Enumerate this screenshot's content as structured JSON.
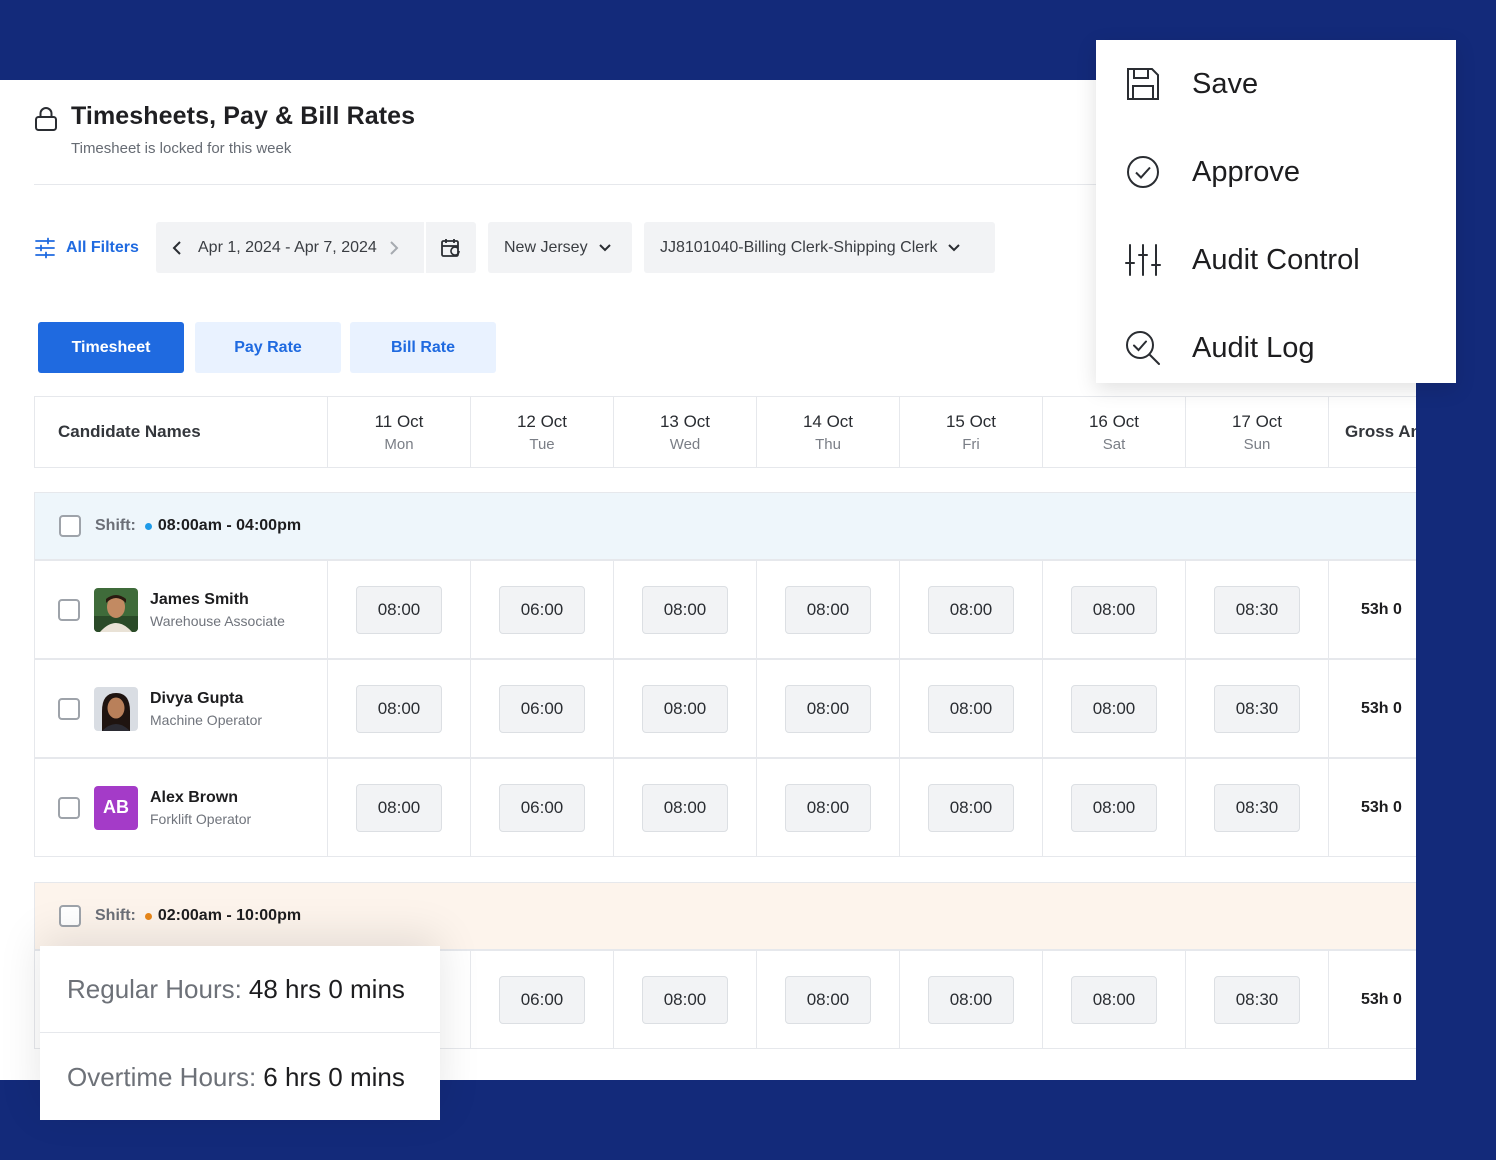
{
  "page": {
    "title": "Timesheets, Pay & Bill Rates",
    "subtitle": "Timesheet is locked for this week"
  },
  "filters": {
    "all_filters_label": "All Filters",
    "date_range": "Apr 1, 2024 - Apr 7, 2024",
    "state": "New Jersey",
    "job": "JJ8101040-Billing Clerk-Shipping Clerk"
  },
  "tabs": [
    {
      "label": "Timesheet",
      "active": true
    },
    {
      "label": "Pay Rate",
      "active": false
    },
    {
      "label": "Bill Rate",
      "active": false
    }
  ],
  "table": {
    "name_header": "Candidate Names",
    "gross_header": "Gross An",
    "days": [
      {
        "date": "11 Oct",
        "dow": "Mon"
      },
      {
        "date": "12 Oct",
        "dow": "Tue"
      },
      {
        "date": "13 Oct",
        "dow": "Wed"
      },
      {
        "date": "14 Oct",
        "dow": "Thu"
      },
      {
        "date": "15 Oct",
        "dow": "Fri"
      },
      {
        "date": "16 Oct",
        "dow": "Sat"
      },
      {
        "date": "17 Oct",
        "dow": "Sun"
      }
    ],
    "shifts": [
      {
        "label": "Shift:",
        "time": "08:00am - 04:00pm",
        "color": "#1e9be9",
        "candidates": [
          {
            "name": "James Smith",
            "role": "Warehouse Associate",
            "avatar": "photo",
            "hours": [
              "08:00",
              "06:00",
              "08:00",
              "08:00",
              "08:00",
              "08:00",
              "08:30"
            ],
            "gross": "53h 0"
          },
          {
            "name": "Divya Gupta",
            "role": "Machine Operator",
            "avatar": "photo",
            "hours": [
              "08:00",
              "06:00",
              "08:00",
              "08:00",
              "08:00",
              "08:00",
              "08:30"
            ],
            "gross": "53h 0"
          },
          {
            "name": "Alex Brown",
            "role": "Forklift Operator",
            "avatar": "AB",
            "hours": [
              "08:00",
              "06:00",
              "08:00",
              "08:00",
              "08:00",
              "08:00",
              "08:30"
            ],
            "gross": "53h 0"
          }
        ]
      },
      {
        "label": "Shift:",
        "time": "02:00am - 10:00pm",
        "color": "#e88719",
        "candidates": [
          {
            "name": "",
            "role": "",
            "avatar": "",
            "hours": [
              "",
              "06:00",
              "08:00",
              "08:00",
              "08:00",
              "08:00",
              "08:30"
            ],
            "gross": "53h 0"
          }
        ]
      }
    ]
  },
  "menu": {
    "items": [
      {
        "label": "Save",
        "icon": "save-icon"
      },
      {
        "label": "Approve",
        "icon": "check-circle-icon"
      },
      {
        "label": "Audit Control",
        "icon": "sliders-icon"
      },
      {
        "label": "Audit Log",
        "icon": "search-check-icon"
      }
    ]
  },
  "hours_summary": {
    "regular_label": "Regular Hours:",
    "regular_value": "48 hrs 0 mins",
    "overtime_label": "Overtime Hours:",
    "overtime_value": "6 hrs 0 mins"
  },
  "colors": {
    "primary": "#1f6ae0",
    "background": "#132a7a",
    "avatar_ab": "#a43bc8"
  }
}
